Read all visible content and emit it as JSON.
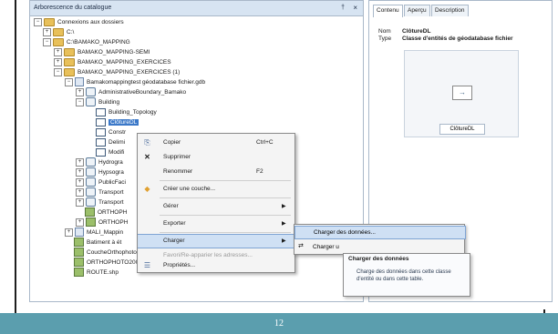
{
  "catalog": {
    "title": "Arborescence du catalogue",
    "pin_glyph": "†",
    "close_glyph": "×",
    "tree": [
      {
        "label": "Connexions aux dossiers",
        "icon": "folder-connection-icon",
        "expander": "−"
      },
      {
        "label": "C:\\",
        "icon": "folder-icon",
        "expander": "+"
      },
      {
        "label": "C:\\BAMAKO_MAPPING",
        "icon": "folder-icon",
        "expander": "−"
      },
      {
        "label": "BAMAKO_MAPPING-SEMI",
        "icon": "folder-icon",
        "expander": "+"
      },
      {
        "label": "BAMAKO_MAPPING_EXERCICES",
        "icon": "folder-icon",
        "expander": "+"
      },
      {
        "label": "BAMAKO_MAPPING_EXERCICES (1)",
        "icon": "folder-icon",
        "expander": "−"
      },
      {
        "label": "Bamakomappingtest géodatabase fichier.gdb",
        "icon": "geodatabase-icon",
        "expander": "−"
      },
      {
        "label": "AdministrativeBoundary_Bamako",
        "icon": "feature-dataset-icon",
        "expander": "+"
      },
      {
        "label": "Building",
        "icon": "feature-dataset-icon",
        "expander": "−"
      },
      {
        "label": "Building_Topology",
        "icon": "topology-icon",
        "expander": ""
      },
      {
        "label": "ClôtureDL",
        "icon": "feature-class-icon",
        "expander": "",
        "selected": true
      },
      {
        "label": "Constr",
        "icon": "feature-class-icon",
        "expander": ""
      },
      {
        "label": "Delimi",
        "icon": "feature-class-icon",
        "expander": ""
      },
      {
        "label": "Modifi",
        "icon": "feature-class-icon",
        "expander": ""
      },
      {
        "label": "Hydrogra",
        "icon": "feature-dataset-icon",
        "expander": "+"
      },
      {
        "label": "Hypsogra",
        "icon": "feature-dataset-icon",
        "expander": "+"
      },
      {
        "label": "PublicFaci",
        "icon": "feature-dataset-icon",
        "expander": "+"
      },
      {
        "label": "Transport",
        "icon": "feature-dataset-icon",
        "expander": "+"
      },
      {
        "label": "Transport",
        "icon": "feature-dataset-icon",
        "expander": "+"
      },
      {
        "label": "ORTHOPH",
        "icon": "raster-icon",
        "expander": ""
      },
      {
        "label": "ORTHOPH",
        "icon": "raster-icon",
        "expander": "+"
      },
      {
        "label": "MALI_Mappin",
        "icon": "geodatabase-icon",
        "expander": "+"
      },
      {
        "label": "Batiment à ét",
        "icon": "shapefile-icon",
        "expander": ""
      },
      {
        "label": "CoucheOrthophoto.shp",
        "icon": "shapefile-icon",
        "expander": ""
      },
      {
        "label": "ORTHOPHOTO200cm.shp",
        "icon": "shapefile-icon",
        "expander": ""
      },
      {
        "label": "ROUTE.shp",
        "icon": "shapefile-icon",
        "expander": ""
      }
    ]
  },
  "details": {
    "tabs": [
      "Contenu",
      "Aperçu",
      "Description"
    ],
    "active_tab": "Contenu",
    "name_key": "Nom",
    "name_value": "ClôtureDL",
    "type_key": "Type",
    "type_value": "Classe d'entités de géodatabase fichier",
    "preview_label": "ClôtureDL"
  },
  "context_menu": {
    "items": [
      {
        "label": "Copier",
        "shortcut": "Ctrl+C",
        "icon": "copy-icon",
        "glyph": "⎘"
      },
      {
        "label": "Supprimer",
        "shortcut": "",
        "icon": "delete-icon",
        "glyph": "✕"
      },
      {
        "label": "Renommer",
        "shortcut": "F2",
        "icon": "",
        "glyph": ""
      },
      {
        "label": "Créer une couche...",
        "shortcut": "",
        "icon": "layer-icon",
        "glyph": "◆"
      },
      {
        "label": "Gérer",
        "shortcut": "",
        "icon": "",
        "glyph": "",
        "submenu": true
      },
      {
        "label": "Exporter",
        "shortcut": "",
        "icon": "",
        "glyph": "",
        "submenu": true
      },
      {
        "label": "Charger",
        "shortcut": "",
        "icon": "",
        "glyph": "",
        "submenu": true,
        "highlighted": true
      },
      {
        "label": "Favori/Re-apparier les adresses...",
        "shortcut": "",
        "icon": "",
        "glyph": "",
        "disabled": true
      },
      {
        "label": "Propriétés...",
        "shortcut": "",
        "icon": "properties-icon",
        "glyph": "☰"
      }
    ],
    "submenu_arrow": "▶"
  },
  "load_submenu": {
    "items": [
      {
        "label": "Charger des données...",
        "highlighted": true
      },
      {
        "label": "Charger u"
      }
    ]
  },
  "tooltip": {
    "title": "Charger des données",
    "body": "Charge des données dans cette classe d'entité ou dans cette table."
  },
  "footer": {
    "page_number": "12"
  }
}
